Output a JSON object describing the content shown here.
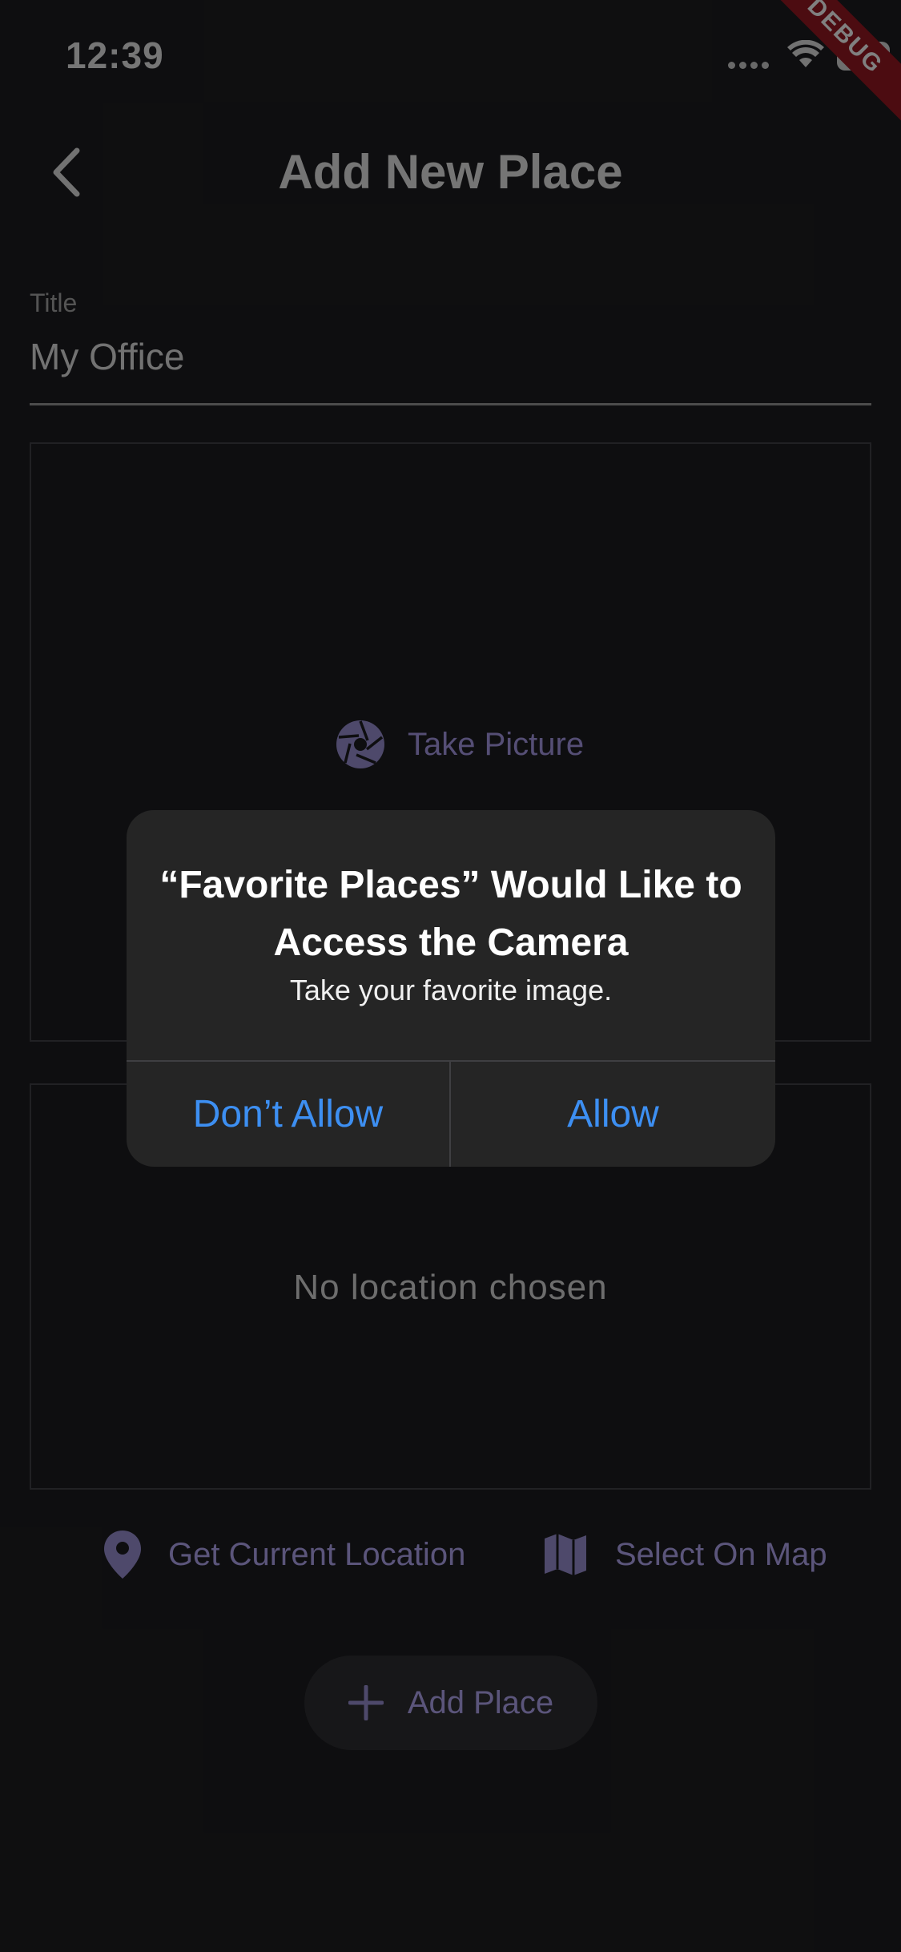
{
  "status_bar": {
    "time": "12:39",
    "battery": "96"
  },
  "debug_banner": "DEBUG",
  "appbar": {
    "title": "Add New Place"
  },
  "form": {
    "title_label": "Title",
    "title_value": "My Office"
  },
  "image_input": {
    "take_picture_label": "Take Picture"
  },
  "location": {
    "empty_text": "No location chosen",
    "get_current_label": "Get Current Location",
    "select_on_map_label": "Select On Map"
  },
  "add_place_label": "Add Place",
  "alert": {
    "title": "“Favorite Places” Would Like to Access the Camera",
    "message": "Take your favorite image.",
    "deny_label": "Don’t Allow",
    "allow_label": "Allow"
  },
  "colors": {
    "accent": "#a79ce0",
    "ios_blue": "#3d8ff2",
    "alert_bg": "#252525",
    "debug": "#8a1620"
  }
}
